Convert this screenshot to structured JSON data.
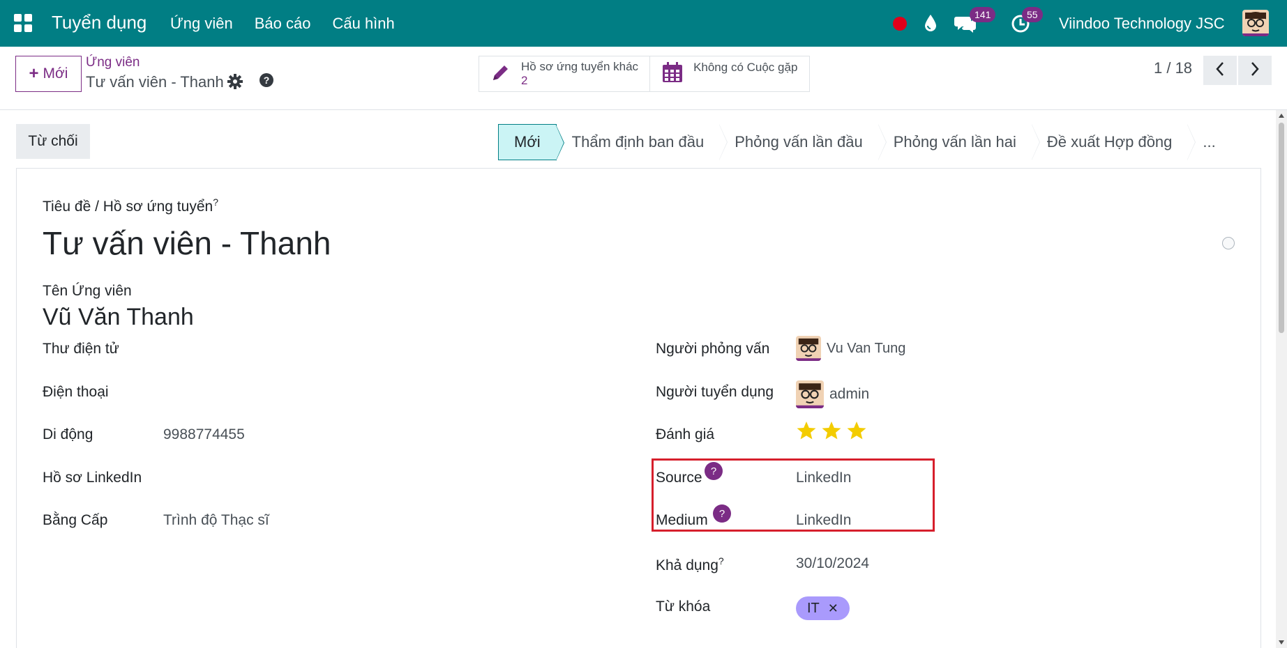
{
  "navbar": {
    "brand": "Tuyển dụng",
    "menu": [
      "Ứng viên",
      "Báo cáo",
      "Cấu hình"
    ],
    "chat_count": "141",
    "activity_count": "55",
    "company": "Viindoo Technology JSC"
  },
  "control": {
    "new_label": "Mới",
    "breadcrumb_parent": "Ứng viên",
    "breadcrumb_current": "Tư vấn viên - Thanh",
    "smart_other_label": "Hồ sơ ứng tuyển khác",
    "smart_other_count": "2",
    "smart_meeting_label": "Không có Cuộc gặp",
    "pager": "1 / 18"
  },
  "status": {
    "refuse_label": "Từ chối",
    "stages": [
      "Mới",
      "Thẩm định ban đầu",
      "Phỏng vấn lần đầu",
      "Phỏng vấn lần hai",
      "Đề xuất Hợp đồng",
      "..."
    ],
    "active_stage": "Mới"
  },
  "form": {
    "title_label": "Tiêu đề / Hồ sơ ứng tuyển",
    "title_help": "?",
    "title_value": "Tư vấn viên - Thanh",
    "name_label": "Tên Ứng viên",
    "name_value": "Vũ Văn Thanh",
    "left_fields": [
      {
        "label": "Thư điện tử",
        "value": ""
      },
      {
        "label": "Điện thoại",
        "value": ""
      },
      {
        "label": "Di động",
        "value": "9988774455"
      },
      {
        "label": "Hồ sơ LinkedIn",
        "value": ""
      },
      {
        "label": "Bằng Cấp",
        "value": "Trình độ Thạc sĩ"
      }
    ],
    "interviewer_label": "Người phỏng vấn",
    "interviewer_value": "Vu Van Tung",
    "recruiter_label": "Người tuyển dụng",
    "recruiter_value": "admin",
    "rating_label": "Đánh giá",
    "rating_value": 3,
    "rating_max": 3,
    "source_label": "Source",
    "source_value": "LinkedIn",
    "medium_label": "Medium",
    "medium_value": "LinkedIn",
    "help_mark": "?",
    "availability_label": "Khả dụng",
    "availability_help": "?",
    "availability_value": "30/10/2024",
    "tags_label": "Từ khóa",
    "tag_value": "IT",
    "tag_remove": "✕"
  },
  "colors": {
    "navbar": "#017e84",
    "accent": "#7b2c85",
    "active_stage": "#cbf4f5",
    "highlight_box": "#d61f2c",
    "star": "#f3cc00",
    "tag": "#a99afc"
  }
}
